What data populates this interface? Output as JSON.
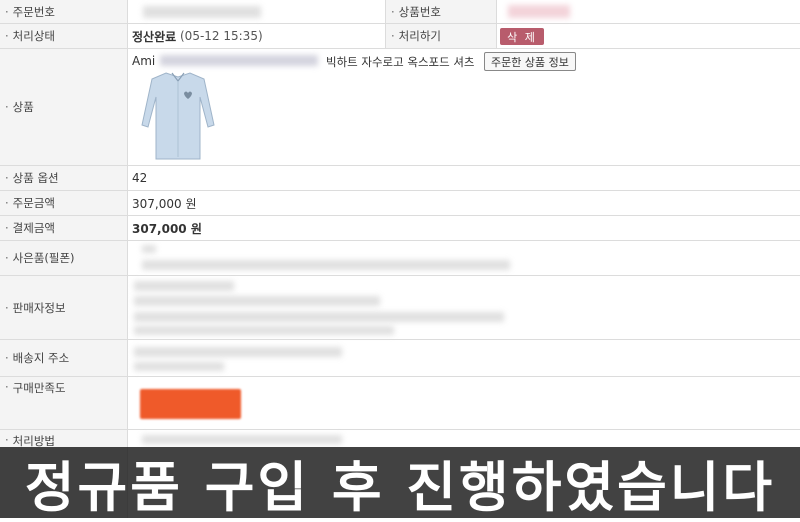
{
  "order": {
    "order_number_label": "주문번호",
    "product_number_label": "상품번호",
    "status_label": "처리상태",
    "status_value": "정산완료",
    "status_time": "(05-12 15:35)",
    "action_label": "처리하기",
    "delete_button": "삭 제",
    "product_label": "상품",
    "product_brand": "Ami",
    "product_name_tail": "빅하트 자수로고 옥스포드 셔츠",
    "product_info_button": "주문한 상품 정보",
    "option_label": "상품 옵션",
    "option_value": "42",
    "order_amount_label": "주문금액",
    "order_amount_value": "307,000 원",
    "payment_amount_label": "결제금액",
    "payment_amount_value": "307,000 원",
    "gift_label": "사은품(필폰)",
    "seller_label": "판매자정보",
    "shipping_label": "배송지 주소",
    "satisfaction_label": "구매만족도",
    "process_label": "처리방법"
  },
  "caption": {
    "text": "정규품 구입 후 진행하였습니다"
  },
  "colors": {
    "delete_button": "#b85c6c",
    "satisfaction_button": "#ef5a2a",
    "label_bg": "#f4f4f4"
  }
}
